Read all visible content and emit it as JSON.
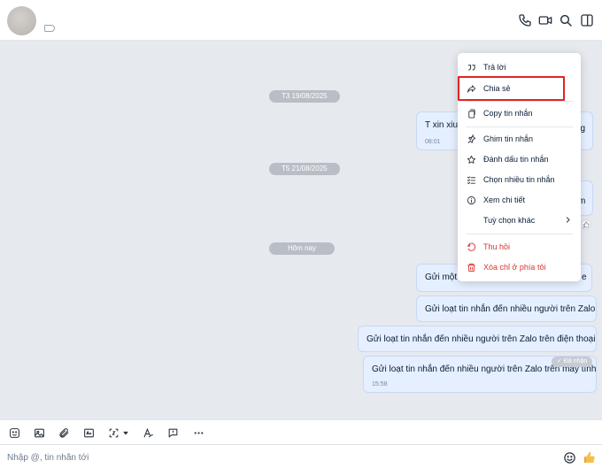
{
  "header": {
    "icons": [
      "phone-icon",
      "video-call-icon",
      "search-icon",
      "side-panel-icon"
    ]
  },
  "chat": {
    "date_separators": [
      "T3 19/08/2025",
      "T5 21/08/2025",
      "Hôm nay"
    ],
    "messages": [
      {
        "text": "T xin xiu",
        "time": "08:01"
      },
      {
        "text": "ng"
      },
      {
        "text": "m"
      },
      {
        "text": "Gửi một"
      },
      {
        "text": "Gửi loạt tin nhắn đến nhiều người trên Zalo"
      },
      {
        "text": "Gửi loạt tin nhắn đến nhiều người trên Zalo trên điện thoại"
      },
      {
        "text": "Gửi loạt tin nhắn đến nhiều người trên Zalo trên máy tính",
        "time": "15:58"
      }
    ],
    "delivered_status": "Đã nhận"
  },
  "context_menu": {
    "items": [
      {
        "label": "Trả lời",
        "icon": "quote-icon"
      },
      {
        "label": "Chia sẻ",
        "icon": "share-icon"
      },
      {
        "label": "Copy tin nhắn",
        "icon": "copy-icon"
      },
      {
        "label": "Ghim tin nhắn",
        "icon": "pin-icon"
      },
      {
        "label": "Đánh dấu tin nhắn",
        "icon": "star-icon"
      },
      {
        "label": "Chọn nhiều tin nhắn",
        "icon": "checklist-icon"
      },
      {
        "label": "Xem chi tiết",
        "icon": "info-icon"
      },
      {
        "label": "Tuỳ chọn khác",
        "icon": "more-options"
      },
      {
        "label": "Thu hồi",
        "icon": "undo-icon"
      },
      {
        "label": "Xóa chỉ ở phía tôi",
        "icon": "trash-icon"
      }
    ],
    "danger_color": "#db342e",
    "highlight_color": "#e02424"
  },
  "composer": {
    "placeholder": "Nhập @, tin nhắn tới"
  },
  "colors": {
    "chat_background": "#e6e9ee",
    "bubble_background": "#e5efff",
    "date_pill": "#b9bec6"
  }
}
